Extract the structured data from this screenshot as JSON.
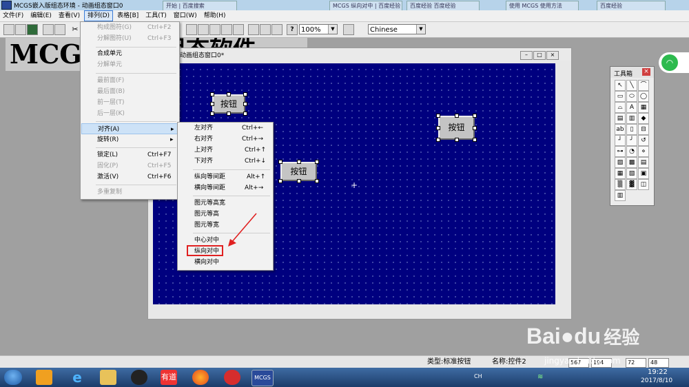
{
  "title_bar": {
    "title": "MCGS嵌入版组态环境 - 动画组态窗口0",
    "bg_tabs": [
      "开始 | 百度搜索",
      "MCGS 纵向对中 | 百度经验",
      "百度经验 百度经验",
      "使用 MCGS 使用方法",
      "百度经验"
    ]
  },
  "menu_bar": {
    "items": [
      "文件(F)",
      "编辑(E)",
      "查看(V)",
      "排列(D)",
      "表格[B]",
      "工具(T)",
      "窗口(W)",
      "帮助(H)"
    ],
    "active": "排列(D)"
  },
  "toolbar": {
    "zoom": "100%",
    "language": "Chinese"
  },
  "background_title": {
    "line1": "MCGS",
    "line2": "组态软件"
  },
  "editor_window": {
    "title": "动画组态窗口0*"
  },
  "canvas": {
    "buttons": [
      "按钮",
      "按钮",
      "按钮"
    ]
  },
  "arrange_menu": {
    "items": [
      {
        "label": "构成图符(G)",
        "shortcut": "Ctrl+F2",
        "disabled": true
      },
      {
        "label": "分解图符(U)",
        "shortcut": "Ctrl+F3",
        "disabled": true
      },
      {
        "label": "合成单元",
        "shortcut": "",
        "disabled": false
      },
      {
        "label": "分解单元",
        "shortcut": "",
        "disabled": true
      },
      {
        "label": "最前面(F)",
        "shortcut": "",
        "disabled": true
      },
      {
        "label": "最后面(B)",
        "shortcut": "",
        "disabled": true
      },
      {
        "label": "前一层(T)",
        "shortcut": "",
        "disabled": true
      },
      {
        "label": "后一层(K)",
        "shortcut": "",
        "disabled": true
      },
      {
        "label": "对齐(A)",
        "shortcut": "",
        "disabled": false
      },
      {
        "label": "旋转(R)",
        "shortcut": "",
        "disabled": false
      },
      {
        "label": "锁定(L)",
        "shortcut": "Ctrl+F7",
        "disabled": false
      },
      {
        "label": "固化(P)",
        "shortcut": "Ctrl+F5",
        "disabled": true
      },
      {
        "label": "激活(V)",
        "shortcut": "Ctrl+F6",
        "disabled": false
      },
      {
        "label": "多重复制",
        "shortcut": "",
        "disabled": true
      }
    ]
  },
  "align_menu": {
    "items": [
      {
        "label": "左对齐",
        "shortcut": "Ctrl+←"
      },
      {
        "label": "右对齐",
        "shortcut": "Ctrl+→"
      },
      {
        "label": "上对齐",
        "shortcut": "Ctrl+↑"
      },
      {
        "label": "下对齐",
        "shortcut": "Ctrl+↓"
      },
      {
        "label": "纵向等间距",
        "shortcut": "Alt+↑"
      },
      {
        "label": "横向等间距",
        "shortcut": "Alt+→"
      },
      {
        "label": "图元等高宽",
        "shortcut": ""
      },
      {
        "label": "图元等高",
        "shortcut": ""
      },
      {
        "label": "图元等宽",
        "shortcut": ""
      },
      {
        "label": "中心对中",
        "shortcut": ""
      },
      {
        "label": "纵向对中",
        "shortcut": ""
      },
      {
        "label": "横向对中",
        "shortcut": ""
      }
    ],
    "highlighted": "纵向对中"
  },
  "toolbox": {
    "title": "工具箱"
  },
  "status_bar": {
    "type": "类型:标准按钮",
    "name": "名称:控件2",
    "values": [
      "567",
      "194",
      "72",
      "48"
    ]
  },
  "taskbar": {
    "apps": [
      "start",
      "media-player",
      "internet-explorer",
      "file-explorer",
      "qq",
      "youdao",
      "firefox",
      "netease-music",
      "mcgs"
    ],
    "youdao_label": "有道",
    "mcgs_label": "MCGS",
    "time": "19:22",
    "date": "2017/8/10",
    "input_lang": "CH"
  },
  "watermark": {
    "brand": "Bai",
    "brand2": "du",
    "text": "经验",
    "url": "jingyan.baidu.com"
  },
  "colors": {
    "canvas": "#00007f",
    "highlight_box": "#e02020",
    "arrow": "#e02020"
  }
}
